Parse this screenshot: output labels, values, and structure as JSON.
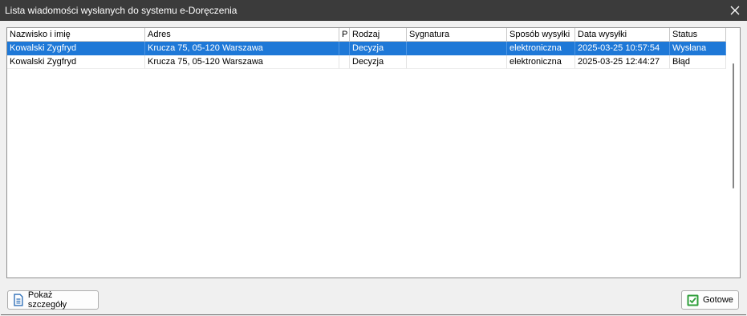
{
  "window": {
    "title": "Lista wiadomości wysłanych do systemu e-Doręczenia",
    "close_label": "✕"
  },
  "grid": {
    "columns": [
      "Nazwisko i imię",
      "Adres",
      "P",
      "Rodzaj",
      "Sygnatura",
      "Sposób wysyłki",
      "Data wysyłki",
      "Status"
    ],
    "rows": [
      [
        "Kowalski Zygfryd",
        "Krucza 75, 05-120 Warszawa",
        "",
        "Decyzja",
        "",
        "elektroniczna",
        "2025-03-25 10:57:54",
        "Wysłana"
      ],
      [
        "Kowalski Zygfryd",
        "Krucza 75, 05-120 Warszawa",
        "",
        "Decyzja",
        "",
        "elektroniczna",
        "2025-03-25 12:44:27",
        "Błąd"
      ]
    ],
    "selected_row": 0
  },
  "buttons": {
    "details_label": "Pokaż szczegóły",
    "done_label": "Gotowe"
  },
  "colors": {
    "titlebar": "#3b3b3b",
    "selection": "#1e78d7",
    "done_icon": "#2e9e3a",
    "details_icon": "#2f6fb7"
  },
  "icons": {
    "details": "document-icon",
    "done": "checkbox-check-icon",
    "close": "close-icon"
  }
}
